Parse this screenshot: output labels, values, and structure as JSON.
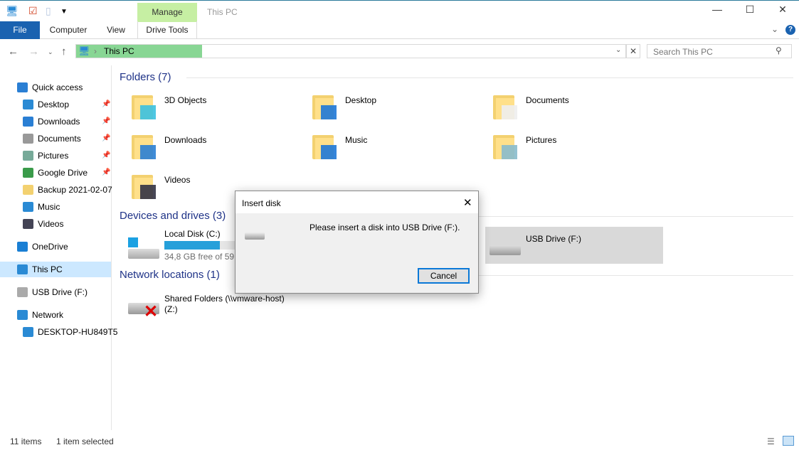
{
  "window": {
    "title": "This PC",
    "context_tab": "Manage",
    "minimize": "—",
    "maximize": "☐",
    "close": "✕"
  },
  "ribbon": {
    "tabs": [
      "File",
      "Computer",
      "View",
      "Drive Tools"
    ],
    "collapse": "⌄",
    "help": "?"
  },
  "address": {
    "path": "This PC",
    "search_placeholder": "Search This PC"
  },
  "sidebar": {
    "items": [
      {
        "label": "Quick access",
        "icon": "star-icon",
        "pinned": false
      },
      {
        "label": "Desktop",
        "icon": "desktop-icon",
        "pinned": true
      },
      {
        "label": "Downloads",
        "icon": "download-icon",
        "pinned": true
      },
      {
        "label": "Documents",
        "icon": "documents-icon",
        "pinned": true
      },
      {
        "label": "Pictures",
        "icon": "pictures-icon",
        "pinned": true
      },
      {
        "label": "Google Drive",
        "icon": "google-drive-icon",
        "pinned": true
      },
      {
        "label": "Backup 2021-02-07",
        "icon": "folder-icon",
        "pinned": false
      },
      {
        "label": "Music",
        "icon": "music-icon",
        "pinned": false
      },
      {
        "label": "Videos",
        "icon": "videos-icon",
        "pinned": false
      },
      {
        "label": "OneDrive",
        "icon": "cloud-icon",
        "pinned": false
      },
      {
        "label": "This PC",
        "icon": "computer-icon",
        "pinned": false,
        "selected": true
      },
      {
        "label": "USB Drive (F:)",
        "icon": "usb-drive-icon",
        "pinned": false
      },
      {
        "label": "Network",
        "icon": "network-icon",
        "pinned": false
      },
      {
        "label": "DESKTOP-HU849T5",
        "icon": "computer-icon",
        "pinned": false
      }
    ]
  },
  "main": {
    "folders_header": "Folders (7)",
    "folders": [
      "3D Objects",
      "Desktop",
      "Documents",
      "Downloads",
      "Music",
      "Pictures",
      "Videos"
    ],
    "devices_header": "Devices and drives (3)",
    "local_disk": {
      "label": "Local Disk (C:)",
      "free": "34,8 GB free of 59,4 GB",
      "used_fraction": 0.41
    },
    "usb": {
      "label": "USB Drive (F:)"
    },
    "network_header": "Network locations (1)",
    "network": {
      "line1": "Shared Folders (\\\\vmware-host)",
      "line2": "(Z:)"
    }
  },
  "dialog": {
    "title": "Insert disk",
    "message": "Please insert a disk into USB Drive (F:).",
    "cancel": "Cancel",
    "close": "✕"
  },
  "status": {
    "items": "11 items",
    "selected": "1 item selected"
  },
  "colors": {
    "accent": "#1a62b0",
    "manage": "#c6efa3",
    "address_highlight": "#88d694",
    "progress": "#26a0da"
  }
}
